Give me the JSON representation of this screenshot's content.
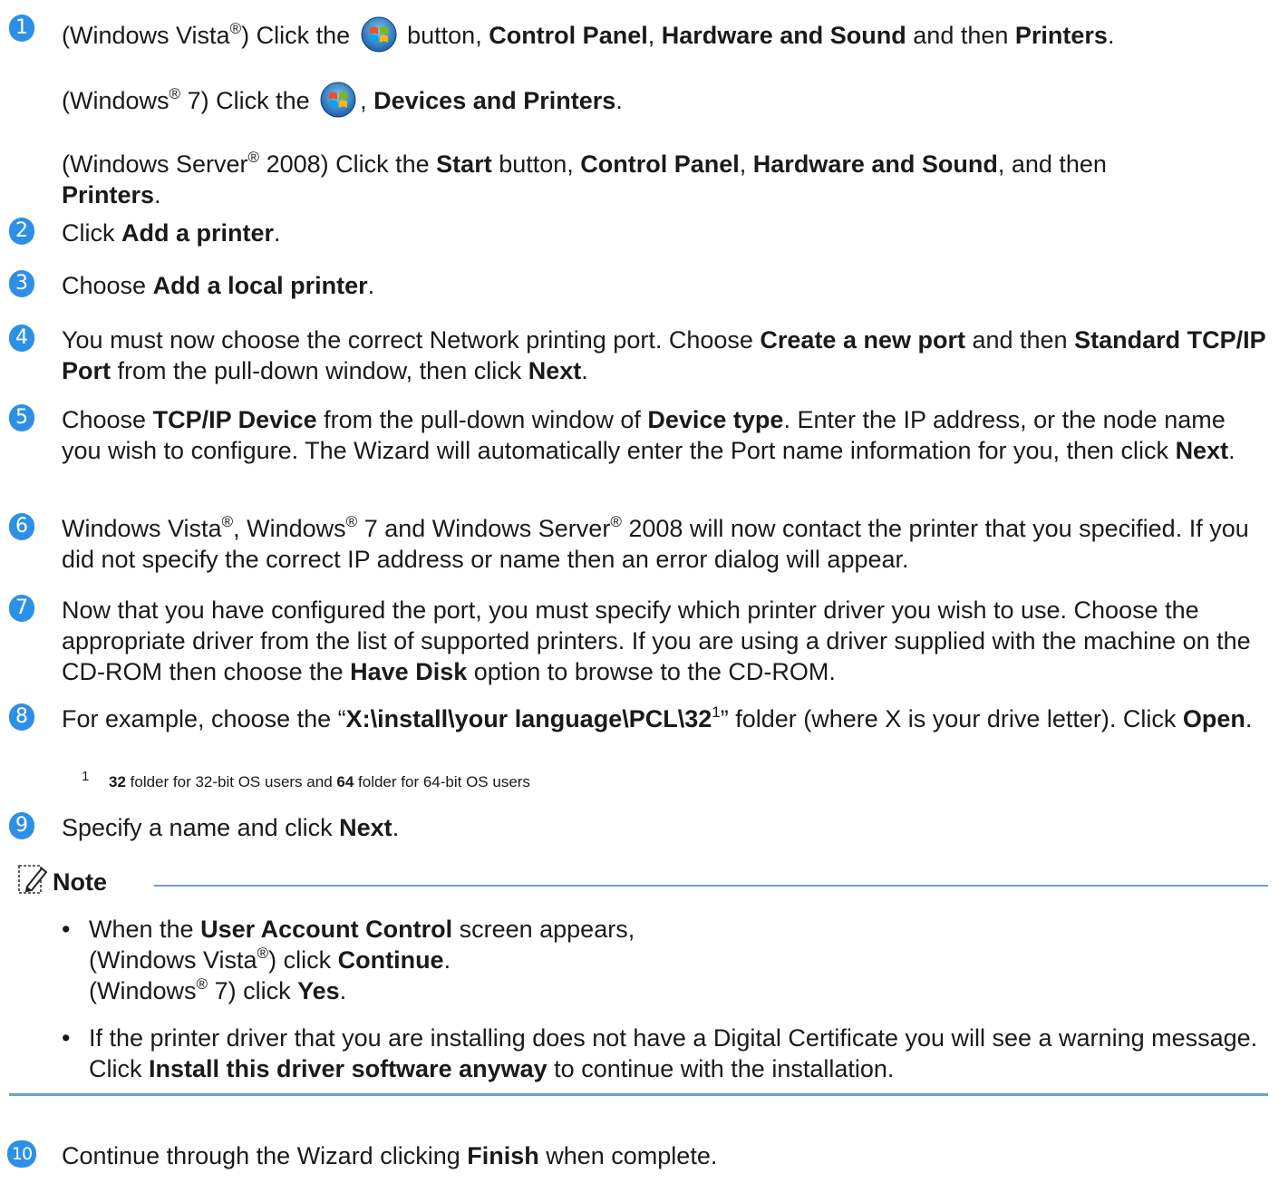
{
  "steps": [
    {
      "num": "1"
    },
    {
      "num": "2",
      "p1": "Click ",
      "b1": "Add a printer",
      "p2": "."
    },
    {
      "num": "3",
      "p1": "Choose ",
      "b1": "Add a local printer",
      "p2": "."
    },
    {
      "num": "4",
      "p1": "You must now choose the correct Network printing port. Choose ",
      "b1": "Create a new port",
      "p2": " and then ",
      "b2": "Standard TCP/IP Port",
      "p3": " from the pull-down window, then click ",
      "b3": "Next",
      "p4": "."
    },
    {
      "num": "5",
      "p1": "Choose ",
      "b1": "TCP/IP Device",
      "p2": " from the pull-down window of ",
      "b2": "Device type",
      "p3": ". Enter the IP address, or the node name you wish to configure. The Wizard will automatically enter the Port name information for you, then click ",
      "b3": "Next",
      "p4": "."
    },
    {
      "num": "6"
    },
    {
      "num": "7",
      "p1": "Now that you have configured the port, you must specify which printer driver you wish to use. Choose the appropriate driver from the list of supported printers. If you are using a driver supplied with the machine on the CD-ROM then choose the ",
      "b1": "Have Disk",
      "p2": " option to browse to the CD-ROM."
    },
    {
      "num": "8",
      "p1": "For example, choose the “",
      "b1": "X:\\install\\your language\\PCL\\32",
      "sup": "1",
      "p2": "” folder (where X is your drive letter). Click ",
      "b2": "Open",
      "p3": "."
    },
    {
      "num": "9",
      "p1": "Specify a name and click ",
      "b1": "Next",
      "p2": "."
    },
    {
      "num": "10",
      "p1": "Continue through the Wizard clicking ",
      "b1": "Finish",
      "p2": " when complete."
    }
  ],
  "step1": {
    "vista_a": "(Windows Vista",
    "reg": "®",
    "vista_b": ") Click the ",
    "vista_c": " button, ",
    "cp": "Control Panel",
    "comma": ", ",
    "hs": "Hardware and Sound",
    "and_then": " and then ",
    "printers": "Printers",
    "dot": ".",
    "w7_a": "(Windows",
    "w7_b": " 7)  Click the ",
    "w7_c": ", ",
    "dp": "Devices and Printers",
    "srv_a": "(Windows Server",
    "srv_b": " 2008) Click the ",
    "start": "Start",
    "srv_c": " button, ",
    "srv_d": ", and then "
  },
  "step6": {
    "a": "Windows Vista",
    "b": ", Windows",
    "c": " 7 and Windows Server",
    "d": " 2008 will now contact the printer that you specified. If you did not specify the correct IP address or name then an error dialog will appear."
  },
  "footnote": {
    "mark": "1",
    "b1": "32",
    "p1": " folder for 32-bit OS users and ",
    "b2": "64",
    "p2": " folder for 64-bit OS users"
  },
  "note": {
    "label": "Note",
    "bullet": "•",
    "uac_a": "When the ",
    "uac_b": "User Account Control",
    "uac_c": " screen appears,",
    "vista_a": "(Windows Vista",
    "vista_b": ") click ",
    "continue": "Continue",
    "w7_a": "(Windows",
    "w7_b": " 7) click ",
    "yes": "Yes",
    "cert_a": "If the printer driver that you are installing does not have a Digital Certificate you will see a warning message. Click ",
    "cert_b": "Install this driver software anyway",
    "cert_c": " to continue with the installation."
  },
  "colors": {
    "step_badge": "#2e8fe6",
    "rule": "#6b9fd8"
  },
  "icons": [
    "windows-start-orb-icon",
    "note-pencil-icon"
  ]
}
